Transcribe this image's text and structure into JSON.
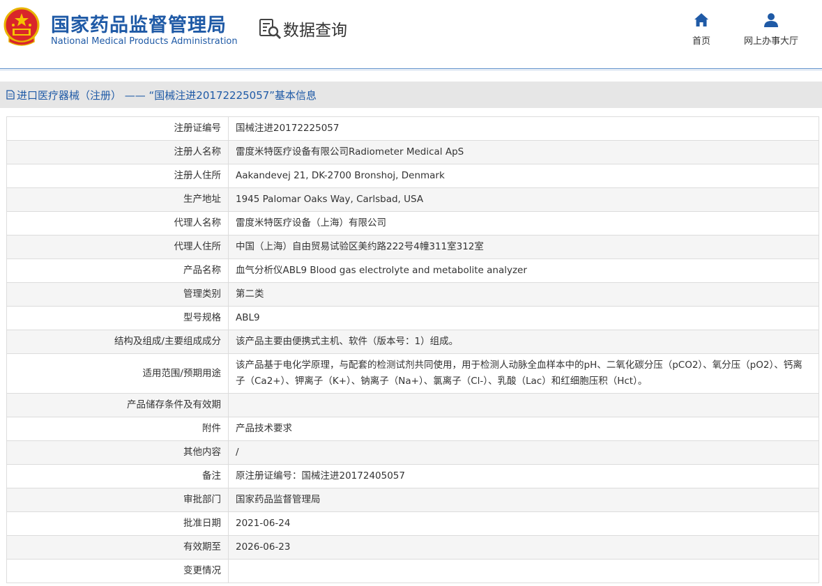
{
  "header": {
    "brand_cn": "国家药品监督管理局",
    "brand_en": "National Medical Products Administration",
    "query_title": "数据查询",
    "nav": {
      "home": "首页",
      "service_hall": "网上办事大厅"
    },
    "accent_color": "#1f5aa6"
  },
  "section": {
    "title": "进口医疗器械（注册） —— “国械注进20172225057”基本信息"
  },
  "rows": [
    {
      "label": "注册证编号",
      "value": "国械注进20172225057"
    },
    {
      "label": "注册人名称",
      "value": "雷度米特医疗设备有限公司Radiometer Medical ApS"
    },
    {
      "label": "注册人住所",
      "value": "Aakandevej 21, DK-2700 Bronshoj, Denmark"
    },
    {
      "label": "生产地址",
      "value": "1945 Palomar Oaks Way, Carlsbad, USA"
    },
    {
      "label": "代理人名称",
      "value": "雷度米特医疗设备（上海）有限公司"
    },
    {
      "label": "代理人住所",
      "value": "中国（上海）自由贸易试验区美约路222号4幢311室312室"
    },
    {
      "label": "产品名称",
      "value": "血气分析仪ABL9 Blood gas electrolyte and metabolite analyzer"
    },
    {
      "label": "管理类别",
      "value": "第二类"
    },
    {
      "label": "型号规格",
      "value": "ABL9"
    },
    {
      "label": "结构及组成/主要组成成分",
      "value": "该产品主要由便携式主机、软件（版本号：1）组成。"
    },
    {
      "label": "适用范围/预期用途",
      "value": "该产品基于电化学原理，与配套的检测试剂共同使用，用于检测人动脉全血样本中的pH、二氧化碳分压（pCO2）、氧分压（pO2）、钙离子（Ca2+）、钾离子（K+）、钠离子（Na+）、氯离子（Cl-）、乳酸（Lac）和红细胞压积（Hct）。"
    },
    {
      "label": "产品储存条件及有效期",
      "value": ""
    },
    {
      "label": "附件",
      "value": "产品技术要求"
    },
    {
      "label": "其他内容",
      "value": "/"
    },
    {
      "label": "备注",
      "value": "原注册证编号：国械注进20172405057"
    },
    {
      "label": "审批部门",
      "value": "国家药品监督管理局"
    },
    {
      "label": "批准日期",
      "value": "2021-06-24"
    },
    {
      "label": "有效期至",
      "value": "2026-06-23"
    },
    {
      "label": "变更情况",
      "value": ""
    }
  ]
}
